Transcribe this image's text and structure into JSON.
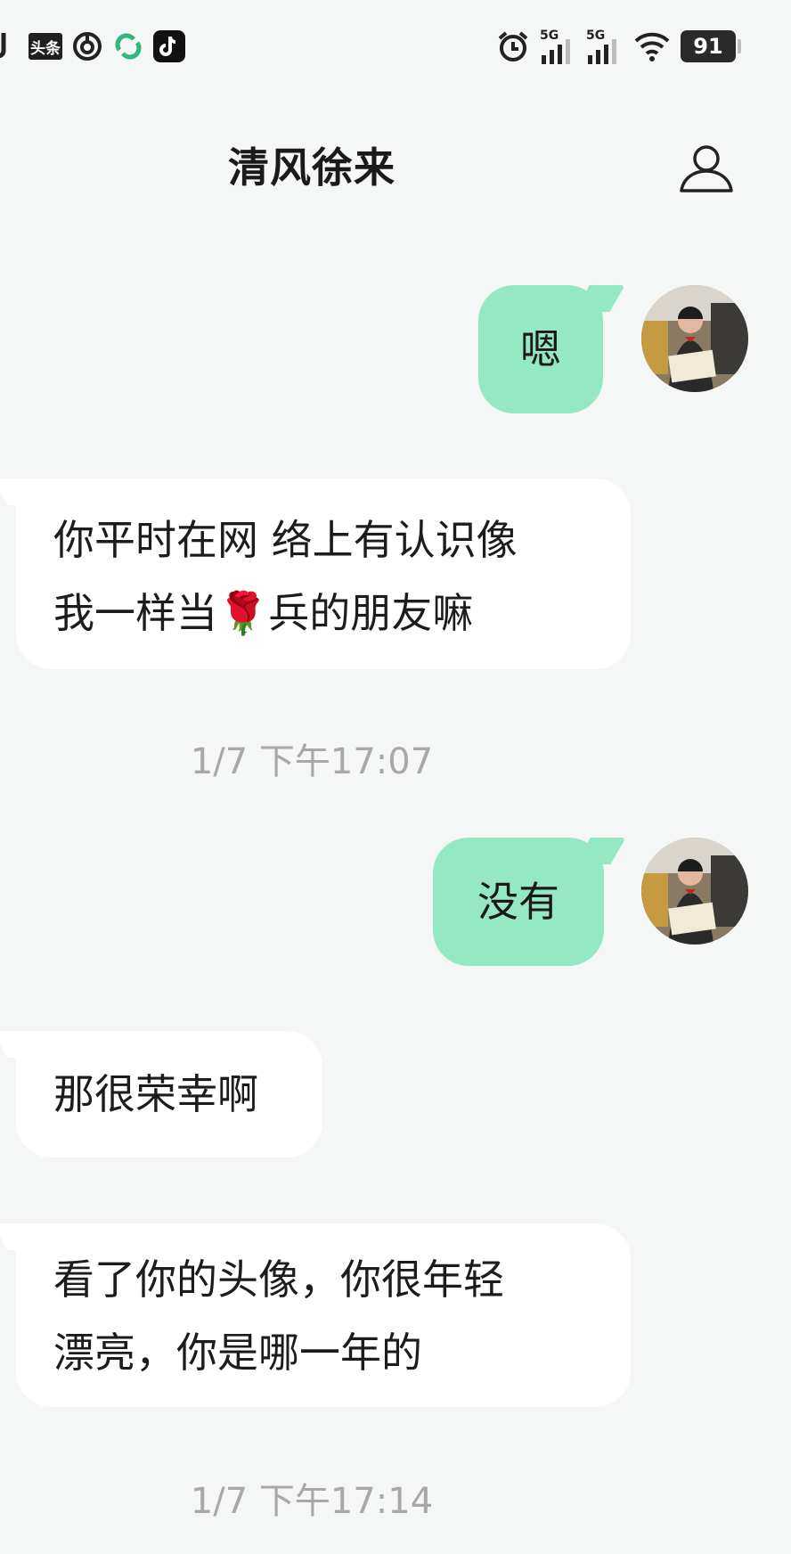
{
  "status_bar": {
    "toutiao_label": "头条",
    "signal1_label": "5G",
    "signal2_label": "5G",
    "battery_level": "91"
  },
  "header": {
    "title": "清风徐来"
  },
  "messages": [
    {
      "direction": "out",
      "text": "嗯"
    },
    {
      "direction": "in",
      "line1": "你平时在网 络上有认识像",
      "line2_before": "我一样当",
      "line2_emoji": "🌹",
      "line2_after": "兵的朋友嘛"
    },
    {
      "direction": "out",
      "text": "没有"
    },
    {
      "direction": "in",
      "text": "那很荣幸啊"
    },
    {
      "direction": "in",
      "line1": "看了你的头像，你很年轻",
      "line2": "漂亮，你是哪一年的"
    }
  ],
  "timestamps": [
    "1/7 下午17:07",
    "1/7 下午17:14"
  ],
  "colors": {
    "background": "#f4f7f6",
    "outgoing_bubble": "#95e8c4",
    "incoming_bubble": "#ffffff",
    "timestamp_text": "#a8a8a8"
  },
  "icons": {
    "profile": "person-outline-icon",
    "alarm": "alarm-clock-icon",
    "wifi": "wifi-icon"
  }
}
